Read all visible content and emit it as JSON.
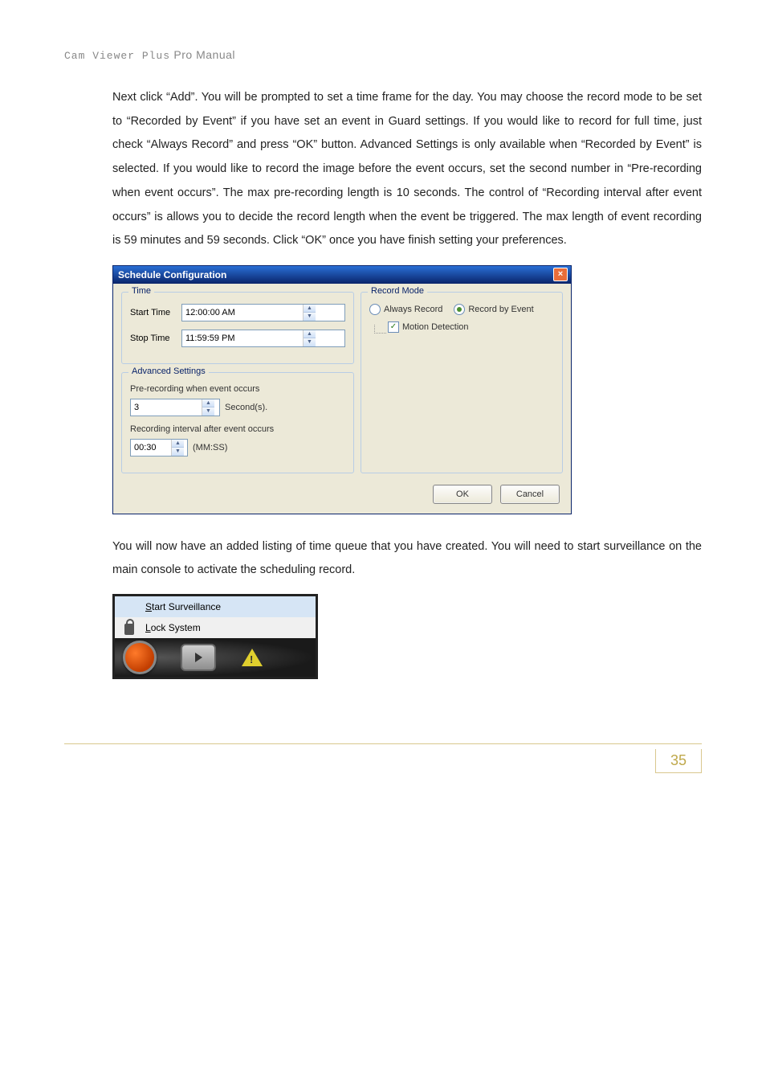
{
  "header": {
    "prefix": "Cam Viewer Plus",
    "suffix": "Pro Manual"
  },
  "paragraph1": "Next click “Add”. You will be prompted to set a time frame for the day. You may choose the record mode to be set to “Recorded by Event” if you have set an event in Guard settings. If you would like to record for full time, just check “Always Record” and press “OK” button. Advanced Settings is only available when “Recorded by Event” is selected. If you would like to record the image before the event occurs, set the second number in “Pre-recording when event occurs”. The max pre-recording length is 10 seconds. The control of “Recording interval after event occurs” is allows you to decide the record length when the event be triggered. The max length of event recording is 59 minutes and 59 seconds. Click “OK” once you have finish setting your preferences.",
  "dialog": {
    "title": "Schedule Configuration",
    "time": {
      "legend": "Time",
      "start_label": "Start Time",
      "start_value": "12:00:00 AM",
      "stop_label": "Stop Time",
      "stop_value": "11:59:59 PM"
    },
    "record_mode": {
      "legend": "Record Mode",
      "always_label": "Always Record",
      "always_checked": false,
      "byevent_label": "Record by Event",
      "byevent_checked": true,
      "motion_label": "Motion Detection",
      "motion_checked": true
    },
    "advanced": {
      "legend": "Advanced Settings",
      "pre_label": "Pre-recording when event occurs",
      "pre_value": "3",
      "pre_unit": "Second(s).",
      "interval_label": "Recording interval after event occurs",
      "interval_value": "00:30",
      "interval_unit": "(MM:SS)"
    },
    "buttons": {
      "ok": "OK",
      "cancel": "Cancel"
    }
  },
  "paragraph2": "You will now have an added listing of time queue that you have created. You will need to start surveillance on the main console to activate the scheduling record.",
  "menu": {
    "start_prefix": "S",
    "start_rest": "tart Surveillance",
    "lock_prefix": "L",
    "lock_rest": "ock System"
  },
  "page_number": "35"
}
